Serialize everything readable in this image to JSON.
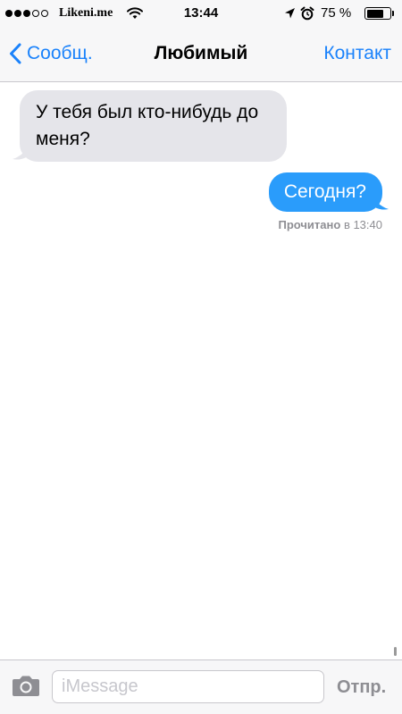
{
  "status_bar": {
    "signal_bars_total": 5,
    "signal_bars_filled": 3,
    "carrier": "Likeni.me",
    "time": "13:44",
    "battery_percent": "75 %",
    "battery_level": 0.75,
    "icons": [
      "wifi-icon",
      "location-arrow-icon",
      "alarm-clock-icon",
      "battery-icon"
    ]
  },
  "nav": {
    "back_label": "Сообщ.",
    "title": "Любимый",
    "contact_label": "Контакт",
    "back_icon": "chevron-left-icon"
  },
  "messages": [
    {
      "direction": "incoming",
      "text": "У тебя был кто-нибудь до меня?"
    },
    {
      "direction": "outgoing",
      "text": "Сегодня?"
    }
  ],
  "read_receipt": {
    "label": "Прочитано",
    "time": "в 13:40"
  },
  "input": {
    "placeholder": "iMessage",
    "value": "",
    "send_label": "Отпр.",
    "camera_icon": "camera-icon"
  },
  "colors": {
    "accent": "#1a82fb",
    "outgoing_bubble": "#2a9cfb",
    "incoming_bubble": "#e5e5ea",
    "bar_background": "#f7f7f8",
    "muted_text": "#8e8e93"
  }
}
